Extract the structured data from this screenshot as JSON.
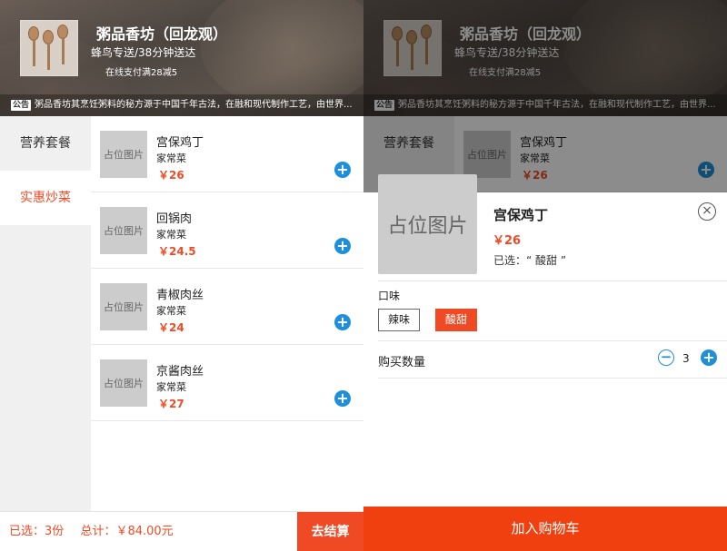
{
  "shop": {
    "name": "粥品香坊（回龙观）",
    "delivery": "蜂鸟专送/38分钟送达",
    "promo": "在线支付满28减5",
    "notice_tag": "公告",
    "notice_text": "粥品香坊其烹饪粥料的秘方源于中国千年古法，在融和现代制作工艺，由世界..."
  },
  "categories": [
    {
      "label": "营养套餐",
      "active": false
    },
    {
      "label": "实惠炒菜",
      "active": true
    }
  ],
  "placeholder_label": "占位图片",
  "foods": [
    {
      "name": "宫保鸡丁",
      "category": "家常菜",
      "price": "￥26"
    },
    {
      "name": "回锅肉",
      "category": "家常菜",
      "price": "￥24.5"
    },
    {
      "name": "青椒肉丝",
      "category": "家常菜",
      "price": "￥24"
    },
    {
      "name": "京酱肉丝",
      "category": "家常菜",
      "price": "￥27"
    }
  ],
  "cart": {
    "selected_label": "已选：",
    "selected_count": "3份",
    "total_label": "总计：",
    "total_value": "￥84.00元",
    "checkout_label": "去结算"
  },
  "modal": {
    "name": "宫保鸡丁",
    "price": "￥26",
    "selected_text": "已选：“ 酸甜 ”",
    "option_label": "口味",
    "options": [
      {
        "label": "辣味",
        "selected": false
      },
      {
        "label": "酸甜",
        "selected": true
      }
    ],
    "qty_label": "购买数量",
    "qty": "3",
    "add_cart_label": "加入购物车"
  },
  "colors": {
    "accent": "#f04a25",
    "blue": "#1e8fd8"
  },
  "icons": {
    "plus": "+",
    "minus": "−",
    "close": "×"
  }
}
